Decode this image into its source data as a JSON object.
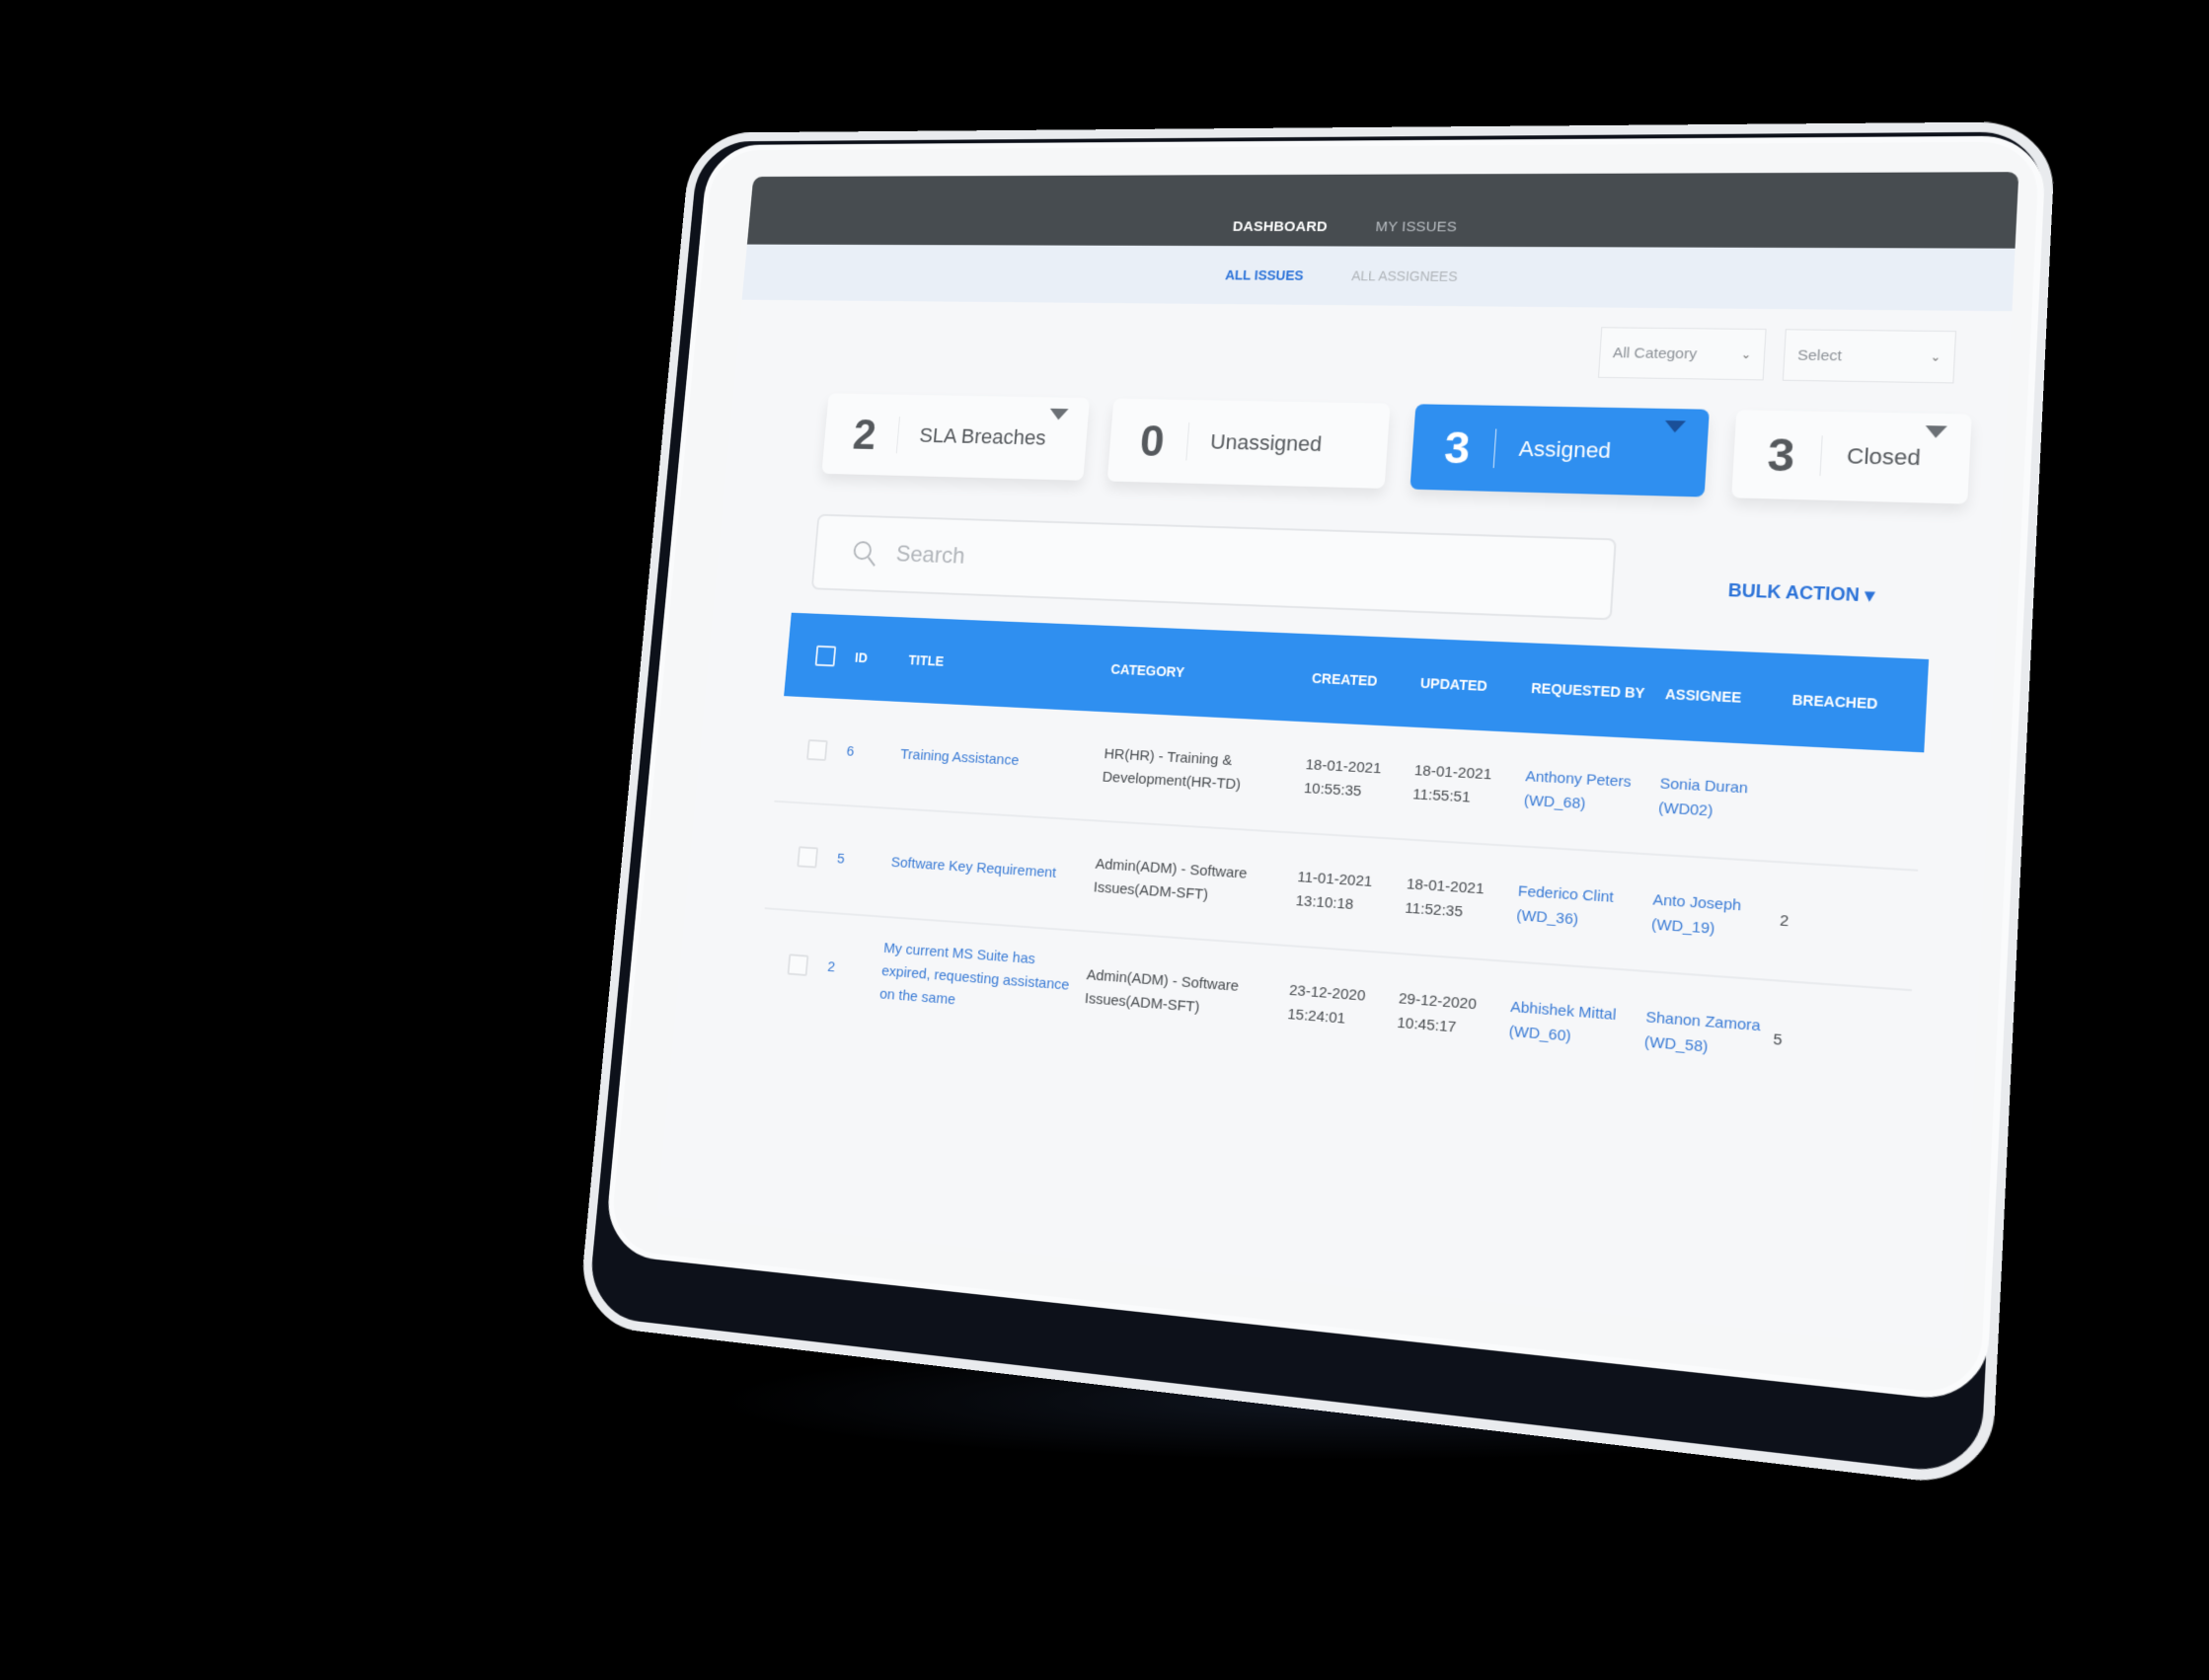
{
  "nav": {
    "top": [
      {
        "label": "DASHBOARD",
        "active": true
      },
      {
        "label": "MY ISSUES",
        "active": false
      }
    ],
    "sub": [
      {
        "label": "ALL ISSUES",
        "active": true
      },
      {
        "label": "ALL ASSIGNEES",
        "active": false
      }
    ]
  },
  "filters": {
    "category": {
      "selected": "All Category"
    },
    "secondary": {
      "selected": "Select"
    }
  },
  "stats": [
    {
      "count": "2",
      "label": "SLA Breaches",
      "has_filter": true,
      "active": false
    },
    {
      "count": "0",
      "label": "Unassigned",
      "has_filter": false,
      "active": false
    },
    {
      "count": "3",
      "label": "Assigned",
      "has_filter": true,
      "active": true
    },
    {
      "count": "3",
      "label": "Closed",
      "has_filter": true,
      "active": false
    }
  ],
  "search": {
    "placeholder": "Search",
    "value": ""
  },
  "bulk_action": {
    "label": "BULK ACTION"
  },
  "colors": {
    "accent": "#2f8ff0",
    "link": "#3a7bd5",
    "topbar": "#474c50",
    "subbar": "#e9eff7"
  },
  "table": {
    "headers": [
      "ID",
      "TITLE",
      "CATEGORY",
      "CREATED",
      "UPDATED",
      "REQUESTED BY",
      "ASSIGNEE",
      "BREACHED"
    ],
    "rows": [
      {
        "id": "6",
        "title": "Training Assistance",
        "category": "HR(HR) - Training & Development(HR-TD)",
        "created": "18-01-2021 10:55:35",
        "updated": "18-01-2021 11:55:51",
        "requested_by": "Anthony Peters (WD_68)",
        "assignee": "Sonia Duran (WD02)",
        "breached": ""
      },
      {
        "id": "5",
        "title": "Software Key Requirement",
        "category": "Admin(ADM) - Software Issues(ADM-SFT)",
        "created": "11-01-2021 13:10:18",
        "updated": "18-01-2021 11:52:35",
        "requested_by": "Federico Clint (WD_36)",
        "assignee": "Anto Joseph (WD_19)",
        "breached": "2"
      },
      {
        "id": "2",
        "title": "My current MS Suite has expired, requesting assistance on the same",
        "category": "Admin(ADM) - Software Issues(ADM-SFT)",
        "created": "23-12-2020 15:24:01",
        "updated": "29-12-2020 10:45:17",
        "requested_by": "Abhishek Mittal (WD_60)",
        "assignee": "Shanon Zamora (WD_58)",
        "breached": "5"
      }
    ]
  }
}
